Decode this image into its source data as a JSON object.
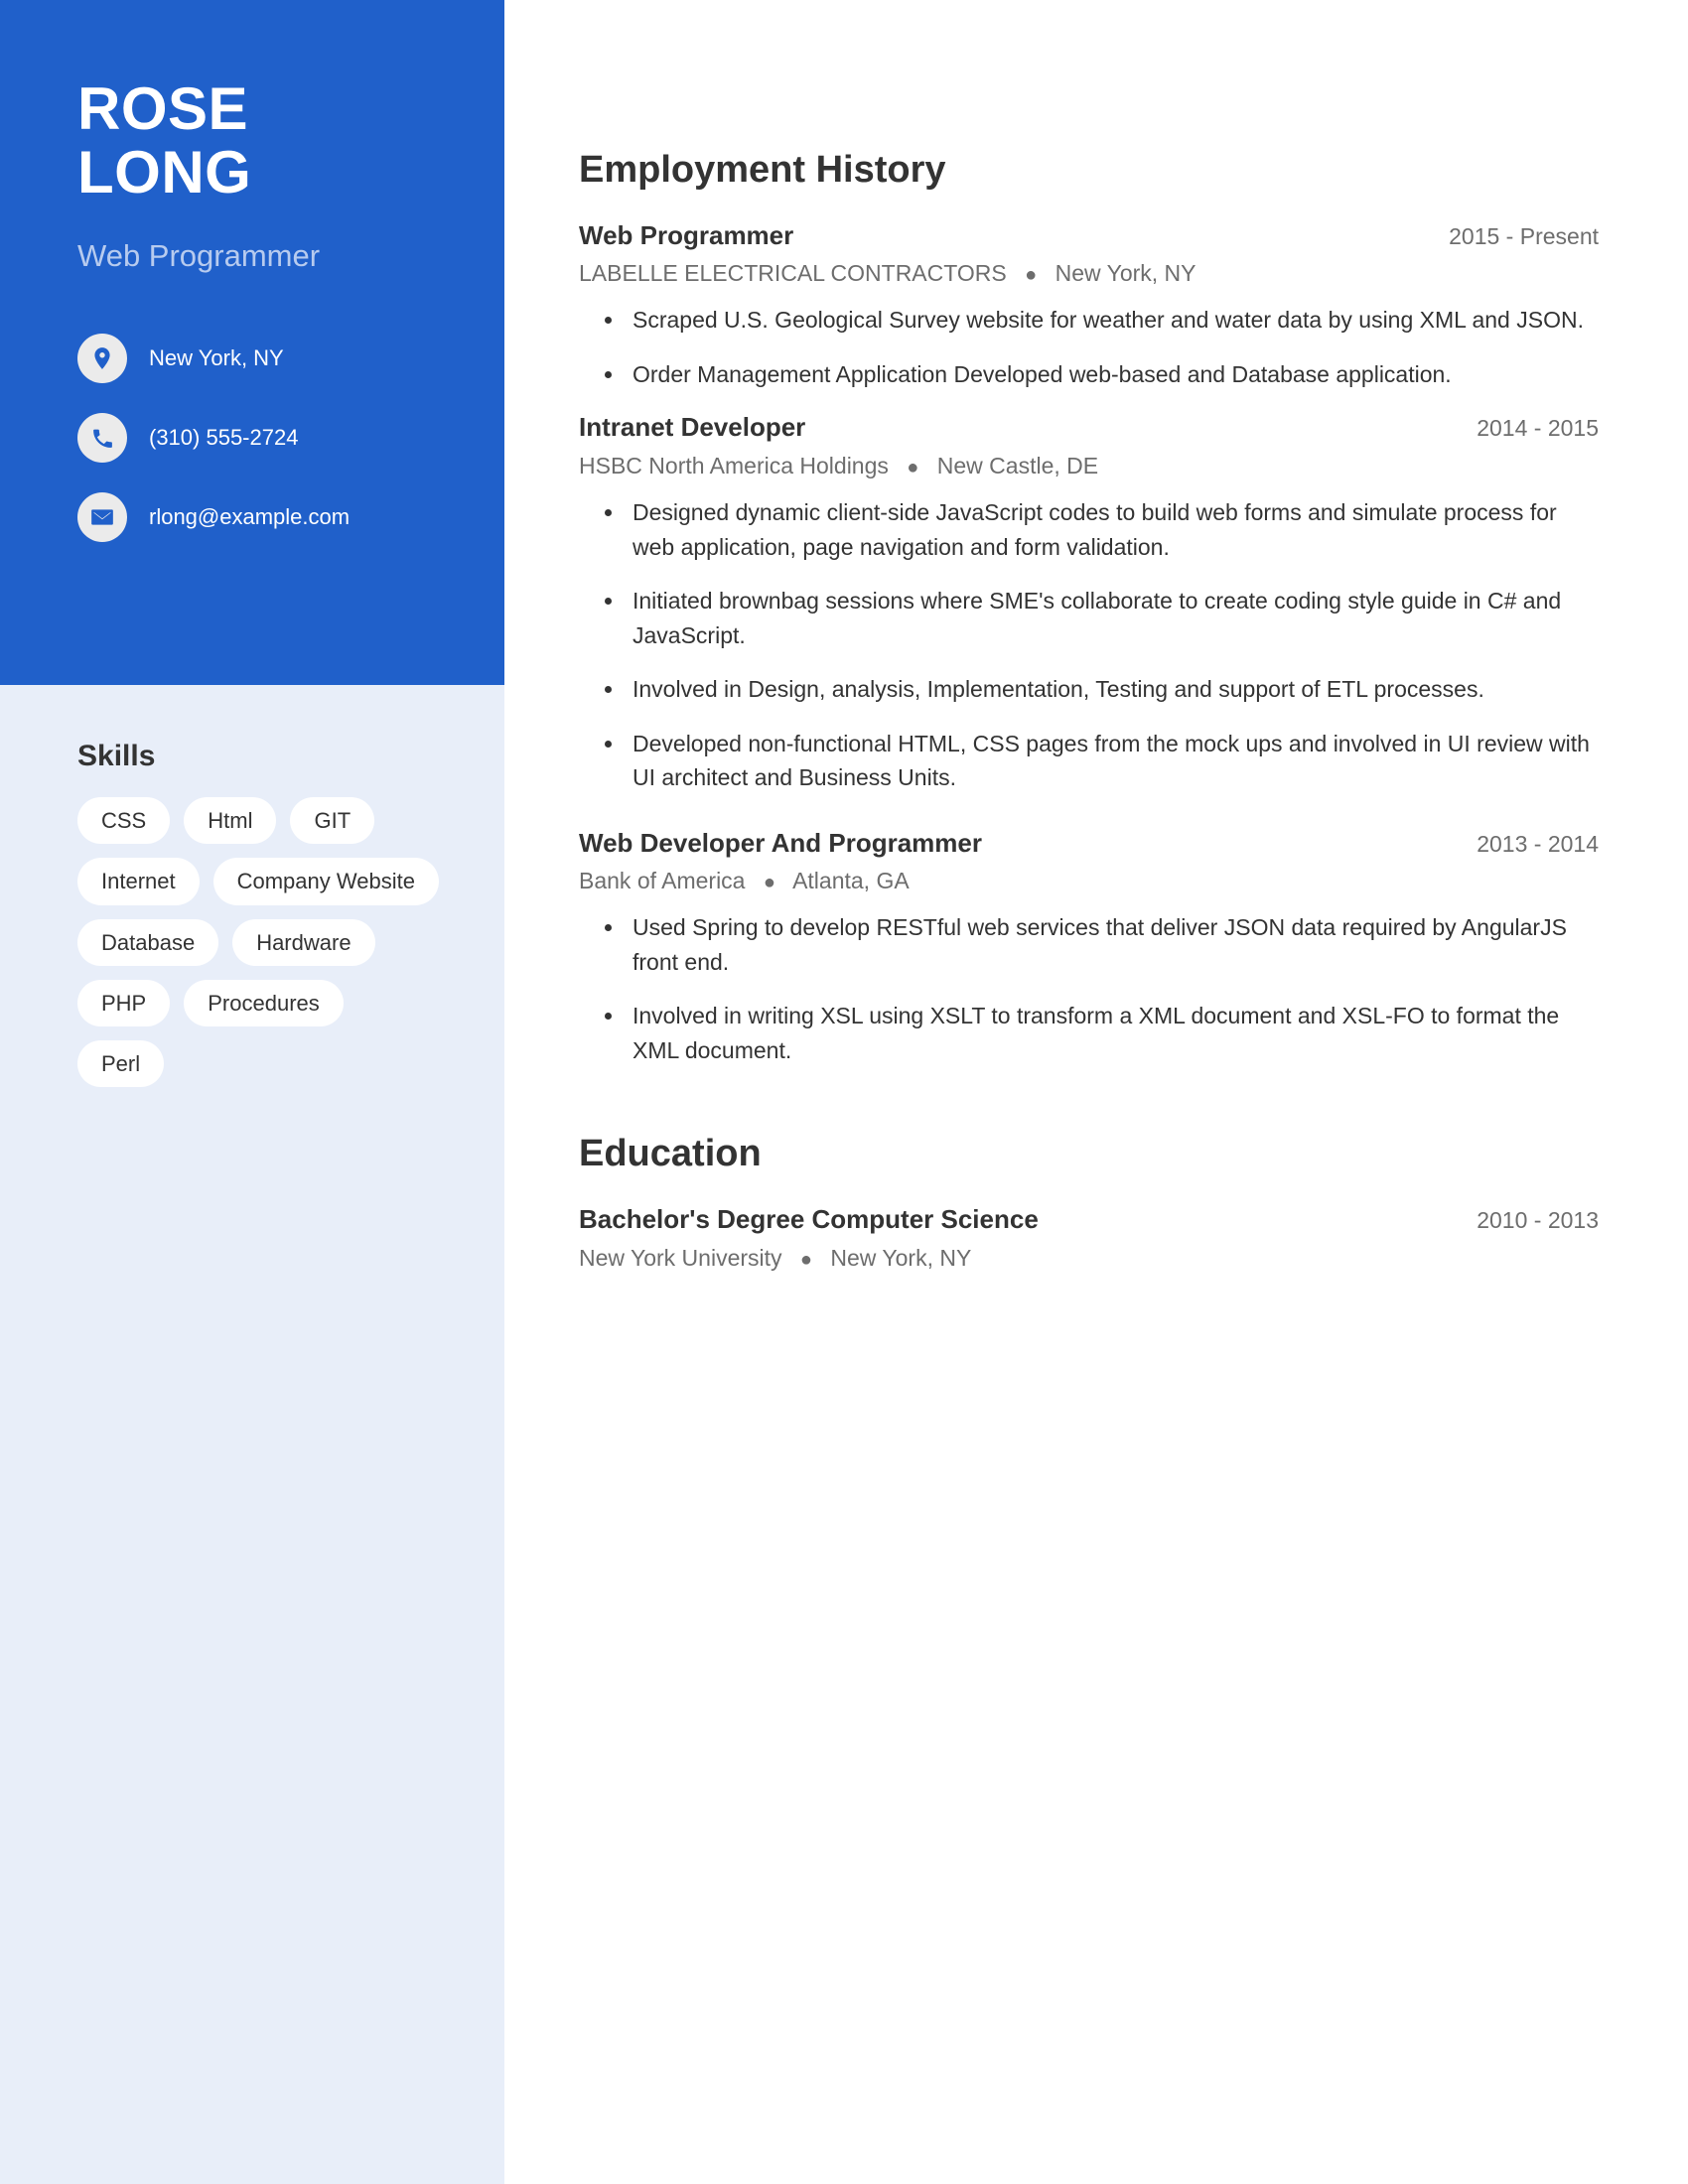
{
  "theme": {
    "primary": "#2060ca",
    "sidebar_bg": "#e8eef9",
    "tag_bg": "#ffffff",
    "text_dark": "#333333",
    "text_muted": "#6d6d6d",
    "subtitle": "#b7cbef"
  },
  "profile": {
    "first_name": "ROSE",
    "last_name": "LONG",
    "job_title": "Web Programmer",
    "contacts": [
      {
        "icon": "location-pin-icon",
        "text": "New York, NY"
      },
      {
        "icon": "phone-icon",
        "text": "(310) 555-2724"
      },
      {
        "icon": "email-icon",
        "text": "rlong@example.com"
      }
    ]
  },
  "skills": {
    "heading": "Skills",
    "tags": [
      "CSS",
      "Html",
      "GIT",
      "Internet",
      "Company Website",
      "Database",
      "Hardware",
      "PHP",
      "Procedures",
      "Perl"
    ]
  },
  "employment": {
    "title": "Employment History",
    "entries": [
      {
        "role": "Web Programmer",
        "dates": "2015 - Present",
        "company": "LABELLE ELECTRICAL CONTRACTORS",
        "separator": "●",
        "location": "New York, NY",
        "bullets": [
          "Scraped U.S. Geological Survey website for weather and water data by using XML and JSON.",
          "Order Management Application Developed web-based and Database application."
        ]
      },
      {
        "role": "Intranet Developer",
        "dates": "2014 - 2015",
        "company": "HSBC North America Holdings",
        "separator": "●",
        "location": "New Castle, DE",
        "bullets": [
          "Designed dynamic client-side JavaScript codes to build web forms and simulate process for web application, page navigation and form validation.",
          "Initiated brownbag sessions where SME's collaborate to create coding style guide in C# and JavaScript.",
          "Involved in Design, analysis, Implementation, Testing and support of ETL processes.",
          "Developed non-functional HTML, CSS pages from the mock ups and involved in UI review with UI architect and Business Units."
        ]
      },
      {
        "role": "Web Developer And Programmer",
        "dates": "2013 - 2014",
        "company": "Bank of America",
        "separator": "●",
        "location": "Atlanta, GA",
        "bullets": [
          "Used Spring to develop RESTful web services that deliver JSON data required by AngularJS front end.",
          "Involved in writing XSL using XSLT to transform a XML document and XSL-FO to format the XML document."
        ]
      }
    ]
  },
  "education": {
    "title": "Education",
    "entries": [
      {
        "degree": "Bachelor's Degree Computer Science",
        "dates": "2010 - 2013",
        "school": "New York University",
        "separator": "●",
        "location": "New York, NY"
      }
    ]
  }
}
